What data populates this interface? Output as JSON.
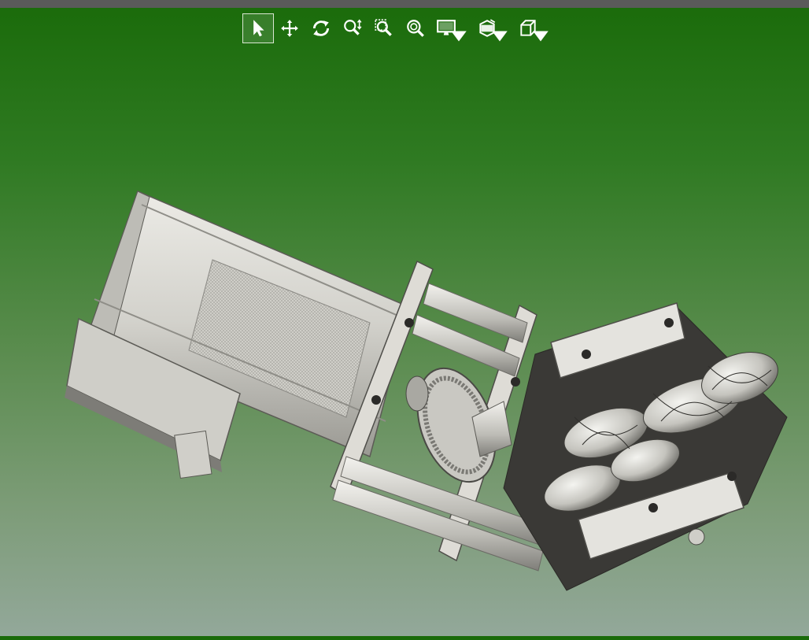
{
  "toolbar": {
    "buttons": [
      {
        "name": "select-tool",
        "icon": "arrow-pointer-icon",
        "active": true
      },
      {
        "name": "pan-tool",
        "icon": "move-arrows-icon",
        "active": false
      },
      {
        "name": "rotate-tool",
        "icon": "rotate-icon",
        "active": false
      },
      {
        "name": "zoom-tool",
        "icon": "zoom-updown-icon",
        "active": false
      },
      {
        "name": "zoom-window-tool",
        "icon": "zoom-window-icon",
        "active": false
      },
      {
        "name": "zoom-fit-tool",
        "icon": "zoom-fit-icon",
        "active": false
      },
      {
        "name": "display-mode-dropdown",
        "icon": "monitor-icon",
        "active": false
      },
      {
        "name": "section-dropdown",
        "icon": "section-view-icon",
        "active": false
      },
      {
        "name": "view-orientation-dropdown",
        "icon": "cube-icon",
        "active": false
      }
    ],
    "icon_color": "#ffffff"
  },
  "viewport": {
    "background_top": "#1a6b0a",
    "background_bottom": "#93a89a",
    "model_color": "#d6d6d0"
  }
}
